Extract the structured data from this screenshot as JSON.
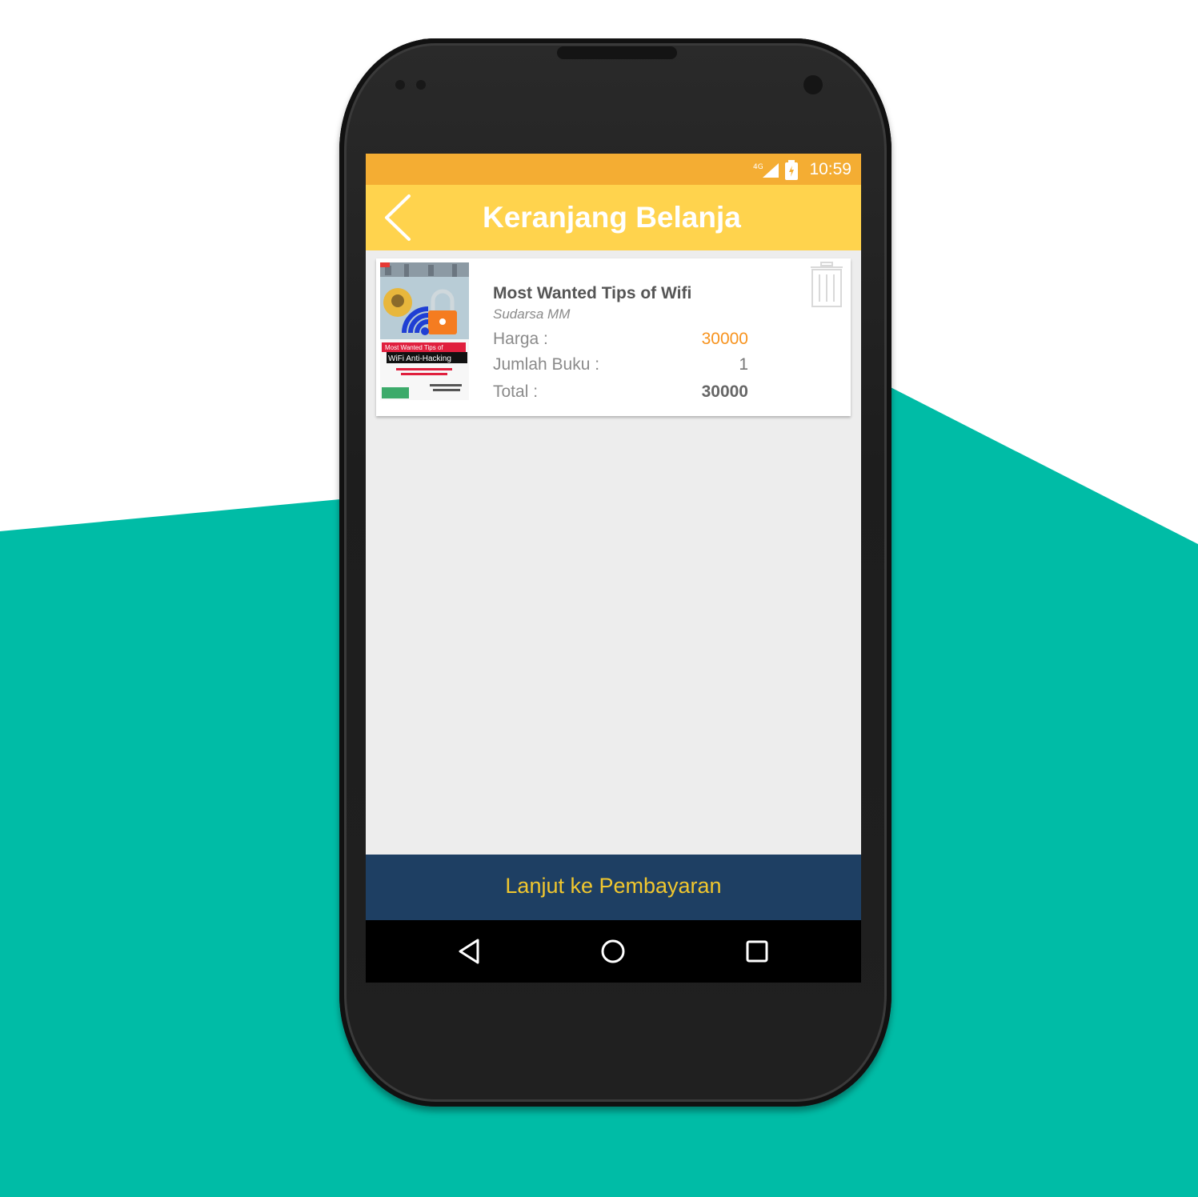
{
  "status_bar": {
    "network": "4G",
    "time": "10:59"
  },
  "app_bar": {
    "title": "Keranjang Belanja",
    "back_icon": "chevron-left-icon"
  },
  "cart": {
    "items": [
      {
        "title": "Most Wanted Tips of Wifi",
        "author": "Sudarsa MM",
        "price_label": "Harga :",
        "price": "30000",
        "quantity_label": "Jumlah Buku :",
        "quantity": "1",
        "total_label": "Total :",
        "total": "30000",
        "cover": {
          "banner_line1": "Most Wanted Tips of",
          "banner_line2": "WiFi Anti-Hacking"
        },
        "delete_icon": "trash-icon"
      }
    ]
  },
  "checkout": {
    "label": "Lanjut ke Pembayaran"
  },
  "nav_bar": {
    "back_icon": "triangle-back-icon",
    "home_icon": "circle-home-icon",
    "recents_icon": "square-recents-icon"
  },
  "colors": {
    "status_bar": "#f4ad33",
    "app_bar": "#ffd34d",
    "checkout_bar": "#1e3f63",
    "checkout_text": "#f1c72e",
    "price": "#f7931e",
    "background_teal": "#00bca6"
  }
}
